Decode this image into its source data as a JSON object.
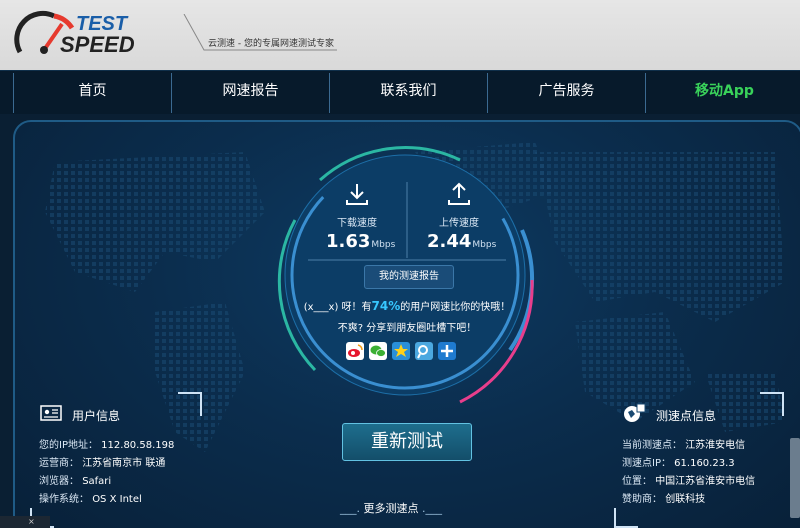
{
  "header": {
    "logo_line1": "TEST",
    "logo_line2": "SPEED",
    "slogan": "云测速 - 您的专属网速测试专家"
  },
  "nav": {
    "items": [
      {
        "label": "首页"
      },
      {
        "label": "网速报告"
      },
      {
        "label": "联系我们"
      },
      {
        "label": "广告服务"
      },
      {
        "label": "移动App"
      }
    ],
    "active_color": "#39d25a"
  },
  "speed": {
    "download_label": "下载速度",
    "download_value": "1.63",
    "download_unit": "Mbps",
    "upload_label": "上传速度",
    "upload_value": "2.44",
    "upload_unit": "Mbps",
    "report_button": "我的测速报告",
    "msg_prefix": "(x___x) 呀！有",
    "msg_percent": "74%",
    "msg_suffix": "的用户网速比你的快哦！",
    "msg_line2": "不爽? 分享到朋友圈吐槽下吧！"
  },
  "share_icons": [
    "weibo-icon",
    "wechat-icon",
    "qzone-icon",
    "tencent-weibo-icon",
    "more-share-icon"
  ],
  "retest_button": "重新测试",
  "more_points": "更多测速点",
  "user_info": {
    "title": "用户信息",
    "ip_label": "您的IP地址：",
    "ip": "112.80.58.198",
    "isp_label": "运营商：",
    "isp": "江苏省南京市 联通",
    "browser_label": "浏览器：",
    "browser": "Safari",
    "os_label": "操作系统：",
    "os": "OS X Intel"
  },
  "node_info": {
    "title": "测速点信息",
    "current_label": "当前测速点：",
    "current": "江苏淮安电信",
    "ip_label": "测速点IP：",
    "ip": "61.160.23.3",
    "location_label": "位置：",
    "location": "中国江苏省淮安市电信",
    "sponsor_label": "赞助商：",
    "sponsor": "创联科技"
  },
  "bottom_close": "×",
  "colors": {
    "accent_blue": "#37c7ff",
    "accent_green": "#39d25a",
    "ring_pink": "#e83e8c",
    "ring_teal": "#2bb7a3"
  }
}
